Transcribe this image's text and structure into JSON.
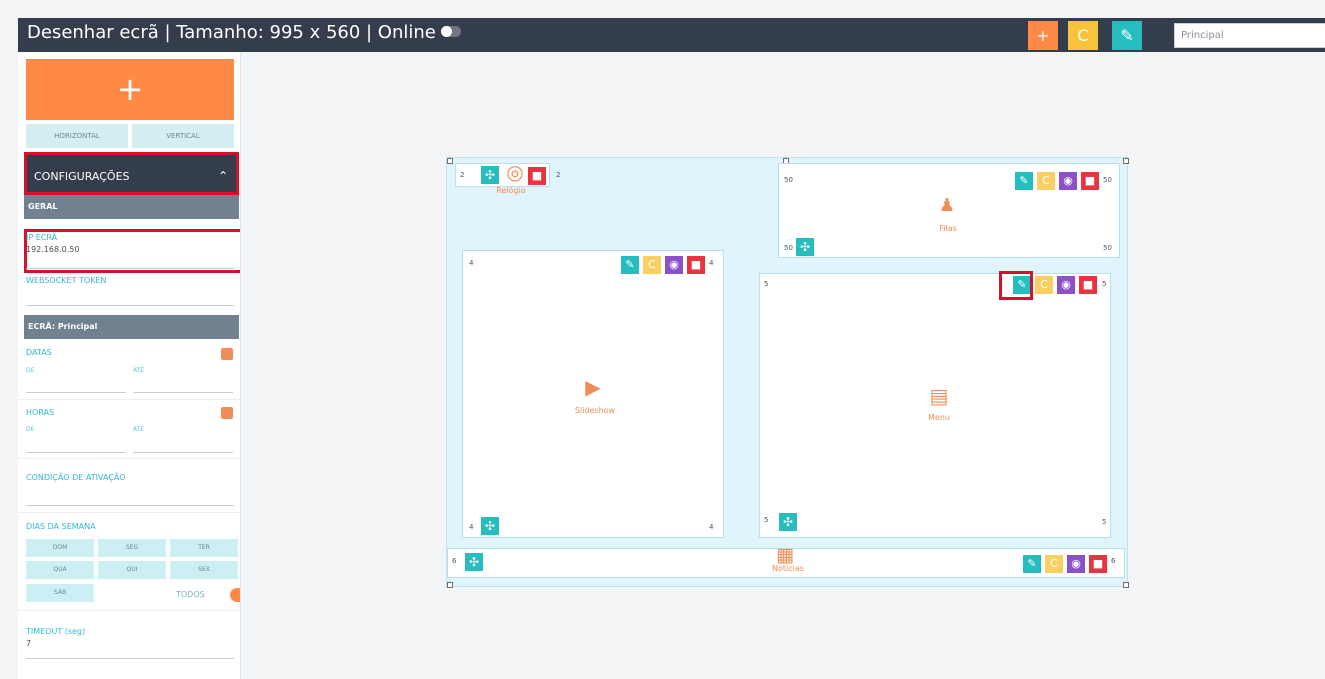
{
  "topbar": {
    "title": "Desenhar ecrã | Tamanho: 995 x 560 | Online",
    "buttons": [
      {
        "label": "+",
        "color": "#ff8a48"
      },
      {
        "label": "C",
        "color": "#f7c33b"
      },
      {
        "label": "✎",
        "color": "#26bdbf"
      }
    ],
    "select_value": "Principal"
  },
  "sidebar": {
    "add_label": "+",
    "horizontal_label": "HORIZONTAL",
    "vertical_label": "VERTICAL",
    "config_label": "CONFIGURAÇÕES",
    "general_label": "GERAL",
    "ip_label": "IP ECRÃ",
    "ip_value": "192.168.0.50",
    "ws_label": "WEBSOCKET TOKEN",
    "screen_label": "ECRÃ: Principal",
    "dates_label": "DATAS",
    "hours_label": "HORAS",
    "from_label": "DE",
    "to_label": "ATÉ",
    "condition_label": "CONDIÇÃO DE ATIVAÇÃO",
    "week_label": "DIAS DA SEMANA",
    "days": [
      "DOM",
      "SEG",
      "TER",
      "QUA",
      "QUI",
      "SEX",
      "SÁB"
    ],
    "all_label": "TODOS",
    "timeout_label": "TIMEOUT (seg)",
    "timeout_value": "7"
  },
  "canvas": {
    "panels": [
      {
        "name": "Relógio"
      },
      {
        "name": "Filas"
      },
      {
        "name": "Slideshow"
      },
      {
        "name": "Menu"
      },
      {
        "name": "Notícias"
      }
    ],
    "labels": {
      "a": "2",
      "b": "2",
      "c": "50",
      "d": "50",
      "e": "50",
      "f": "50",
      "g": "4",
      "h": "4",
      "i": "4",
      "j": "4",
      "k": "5",
      "l": "5",
      "m": "5",
      "n": "5",
      "o": "6",
      "p": "6"
    }
  },
  "colors": {
    "orange": "#ff8a48",
    "yellow": "#f9cf63",
    "teal": "#26bdbf",
    "purple": "#8a51c9",
    "red": "#eb3241",
    "dark": "#343d4c",
    "highlight": "#d4112b"
  },
  "icons": {
    "add": "plus-icon",
    "refresh": "refresh-icon",
    "edit": "pencil-icon",
    "view": "eye-icon",
    "delete": "trash-icon",
    "move": "move-icon"
  }
}
